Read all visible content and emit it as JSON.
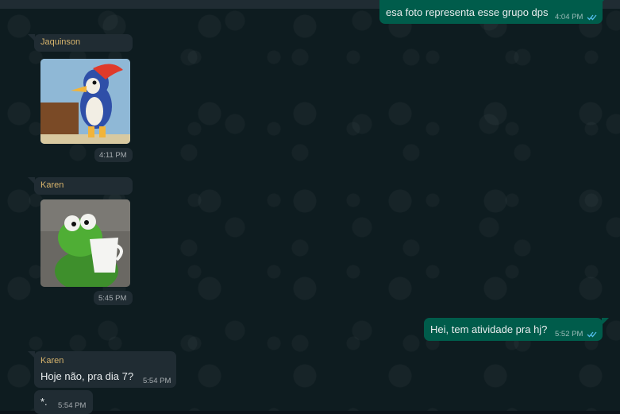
{
  "chat": {
    "out1": {
      "text": "esa foto representa esse grupo dps",
      "time": "4:04 PM",
      "status_icon": "double-check-read-icon"
    },
    "in1": {
      "sender": "Jaquinson",
      "image": "woody-woodpecker-sticker",
      "time": "4:11 PM"
    },
    "in2": {
      "sender": "Karen",
      "image": "kermit-drinking-tea-sticker",
      "time": "5:45 PM"
    },
    "out2": {
      "text": "Hei, tem atividade pra hj?",
      "time": "5:52 PM",
      "status_icon": "double-check-read-icon"
    },
    "in3": {
      "sender": "Karen",
      "text": "Hoje não, pra dia 7?",
      "time": "5:54 PM"
    },
    "in4": {
      "text": "*.",
      "time": "5:54 PM"
    }
  },
  "colors": {
    "outgoing_bubble": "#005c4b",
    "incoming_bubble": "#202c33",
    "sender_name": "#d6b36c",
    "read_ticks": "#53bdeb"
  }
}
